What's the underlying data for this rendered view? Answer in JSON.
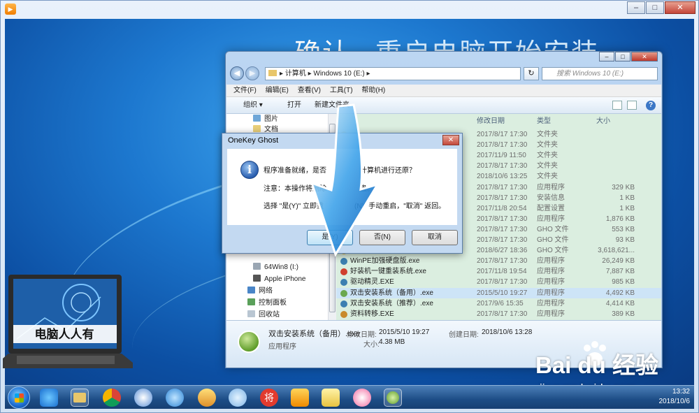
{
  "heading": {
    "main": "确认",
    "sub": "重启电脑开始安装"
  },
  "explorer": {
    "address": [
      "计算机",
      "Windows 10 (E:)"
    ],
    "search_placeholder": "搜索 Windows 10 (E:)",
    "menu": [
      "文件(F)",
      "编辑(E)",
      "查看(V)",
      "工具(T)",
      "帮助(H)"
    ],
    "commands": [
      "组织 ▾",
      "打开",
      "新建文件夹"
    ],
    "nav_items": [
      "图片",
      "文档",
      "64Win8 (I:)",
      "Apple iPhone",
      "网络",
      "控制面板",
      "回收站"
    ],
    "columns": {
      "date": "修改日期",
      "type": "类型",
      "size": "大小"
    },
    "rows": [
      {
        "name": "",
        "date": "2017/8/17 17:30",
        "type": "文件夹",
        "size": ""
      },
      {
        "name": "",
        "date": "2017/8/17 17:30",
        "type": "文件夹",
        "size": ""
      },
      {
        "name": "",
        "date": "2017/11/9 11:50",
        "type": "文件夹",
        "size": ""
      },
      {
        "name": "",
        "date": "2017/8/17 17:30",
        "type": "文件夹",
        "size": ""
      },
      {
        "name": "",
        "date": "2018/10/6 13:25",
        "type": "文件夹",
        "size": ""
      },
      {
        "name": "",
        "date": "2017/8/17 17:30",
        "type": "应用程序",
        "size": "329 KB"
      },
      {
        "name": "",
        "date": "2017/8/17 17:30",
        "type": "安装信息",
        "size": "1 KB"
      },
      {
        "name": "",
        "date": "2017/11/8 20:54",
        "type": "配置设置",
        "size": "1 KB"
      },
      {
        "name": "",
        "date": "2017/8/17 17:30",
        "type": "应用程序",
        "size": "1,876 KB"
      },
      {
        "name": "",
        "date": "2017/8/17 17:30",
        "type": "GHO 文件",
        "size": "553 KB"
      },
      {
        "name": "",
        "date": "2017/8/17 17:30",
        "type": "GHO 文件",
        "size": "93 KB"
      },
      {
        "name": "",
        "date": "2018/6/27 18:36",
        "type": "GHO 文件",
        "size": "3,618,621..."
      },
      {
        "name": "WinPE加强硬盘版.exe",
        "date": "2017/8/17 17:30",
        "type": "应用程序",
        "size": "26,249 KB"
      },
      {
        "name": "好装机一键重装系统.exe",
        "date": "2017/11/8 19:54",
        "type": "应用程序",
        "size": "7,887 KB"
      },
      {
        "name": "驱动精灵.EXE",
        "date": "2017/8/17 17:30",
        "type": "应用程序",
        "size": "985 KB"
      },
      {
        "name": "双击安装系统（备用）.exe",
        "date": "2015/5/10 19:27",
        "type": "应用程序",
        "size": "4,492 KB"
      },
      {
        "name": "双击安装系统（推荐）.exe",
        "date": "2017/9/6 15:35",
        "type": "应用程序",
        "size": "4,414 KB"
      },
      {
        "name": "资料转移.EXE",
        "date": "2017/8/17 17:30",
        "type": "应用程序",
        "size": "389 KB"
      }
    ],
    "details": {
      "name": "双击安装系统（备用）.exe",
      "type": "应用程序",
      "modified_label": "修改日期:",
      "modified": "2015/5/10 19:27",
      "created_label": "创建日期:",
      "created": "2018/10/6 13:28",
      "size_label": "大小:",
      "size": "4.38 MB"
    }
  },
  "dialog": {
    "title": "OneKey Ghost",
    "line1a": "程序准备就绪，是否",
    "line1b": "计算机进行还原？",
    "line2a": "注意：本操作将删除",
    "line2b": "盘。",
    "line3a": "选择 \"是(Y)\" 立即重",
    "line3b": "(N)\" 手动重启，\"取消\" 返回。",
    "yes": "是(Y)",
    "no": "否(N)",
    "cancel": "取消"
  },
  "laptop_caption": "电脑人人有",
  "watermark": {
    "main": "Bai  du 经验",
    "url": "jingyan.baidu.com"
  },
  "tray": {
    "time": "13:32",
    "date": "2018/10/6"
  },
  "colors": {
    "desktop": "#1d78cf",
    "dialog_frame": "#c3d9f1",
    "selection": "#cde4f7"
  }
}
